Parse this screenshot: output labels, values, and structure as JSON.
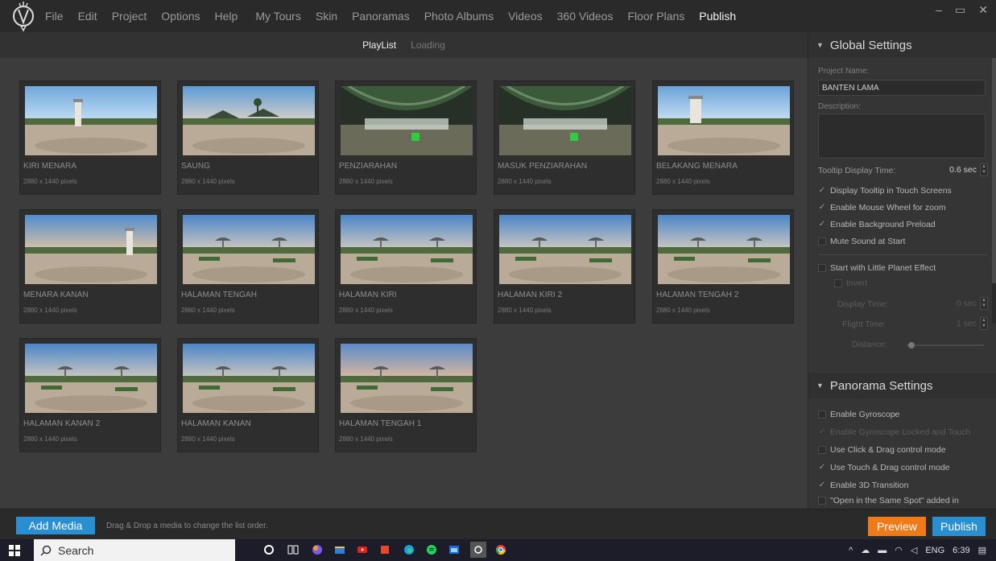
{
  "menu": {
    "items": [
      "File",
      "Edit",
      "Project",
      "Options",
      "Help",
      "My Tours",
      "Skin",
      "Panoramas",
      "Photo Albums",
      "Videos",
      "360 Videos",
      "Floor Plans",
      "Publish"
    ],
    "active": "Publish",
    "window_controls": [
      "–",
      "▭",
      "✕"
    ]
  },
  "subtabs": {
    "playlist": "PlayList",
    "loading": "Loading"
  },
  "gallery": {
    "items": [
      {
        "name": "KIRI MENARA",
        "dims": "2880 x 1440 pixels",
        "scene": "tower"
      },
      {
        "name": "SAUNG",
        "dims": "2880 x 1440 pixels",
        "scene": "pavilion"
      },
      {
        "name": "PENZIARAHAN",
        "dims": "2880 x 1440 pixels",
        "scene": "hall"
      },
      {
        "name": "MASUK PENZIARAHAN",
        "dims": "2880 x 1440 pixels",
        "scene": "hall"
      },
      {
        "name": "BELAKANG MENARA",
        "dims": "2880 x 1440 pixels",
        "scene": "tower-close"
      },
      {
        "name": "MENARA KANAN",
        "dims": "2880 x 1440 pixels",
        "scene": "tower-right"
      },
      {
        "name": "HALAMAN TENGAH",
        "dims": "2880 x 1440 pixels",
        "scene": "plaza"
      },
      {
        "name": "HALAMAN KIRI",
        "dims": "2880 x 1440 pixels",
        "scene": "plaza"
      },
      {
        "name": "HALAMAN KIRI 2",
        "dims": "2880 x 1440 pixels",
        "scene": "plaza"
      },
      {
        "name": "HALAMAN TENGAH 2",
        "dims": "2880 x 1440 pixels",
        "scene": "plaza"
      },
      {
        "name": "HALAMAN KANAN 2",
        "dims": "2880 x 1440 pixels",
        "scene": "plaza"
      },
      {
        "name": "HALAMAN KANAN",
        "dims": "2880 x 1440 pixels",
        "scene": "plaza"
      },
      {
        "name": "HALAMAN TENGAH 1",
        "dims": "2880 x 1440 pixels",
        "scene": "plaza-dusk"
      }
    ]
  },
  "global_settings": {
    "title": "Global Settings",
    "project_name_label": "Project Name:",
    "project_name_value": "BANTEN LAMA",
    "description_label": "Description:",
    "tooltip_time_label": "Tooltip Display Time:",
    "tooltip_time_value": "0.6 sec",
    "display_tooltip_touch": "Display Tooltip in Touch Screens",
    "enable_mouse_wheel": "Enable Mouse Wheel for zoom",
    "enable_bg_preload": "Enable Background Preload",
    "mute_sound": "Mute Sound at Start",
    "little_planet": "Start with Little Planet Effect",
    "invert": "Invert",
    "display_time_label": "Display Time:",
    "display_time_value": "0 sec",
    "flight_time_label": "Flight Time:",
    "flight_time_value": "1 sec",
    "distance_label": "Distance:"
  },
  "panorama_settings": {
    "title": "Panorama Settings",
    "enable_gyroscope": "Enable Gyroscope",
    "gyro_locked": "Enable Gyroscope Locked and Touch",
    "click_drag": "Use Click & Drag control mode",
    "touch_drag": "Use Touch & Drag control mode",
    "transition_3d": "Enable 3D Transition",
    "open_same_spot": "\"Open in the Same Spot\" added in"
  },
  "bottombar": {
    "add_media": "Add Media",
    "hint": "Drag & Drop a media to change the list order.",
    "preview": "Preview",
    "publish": "Publish"
  },
  "taskbar": {
    "search": "Search",
    "lang": "ENG",
    "time": "6:39"
  },
  "colors": {
    "accent_blue": "#2a8fd0",
    "accent_orange": "#ef7a1a",
    "panel_bg": "#353535",
    "gallery_bg": "#3c3c3c"
  }
}
